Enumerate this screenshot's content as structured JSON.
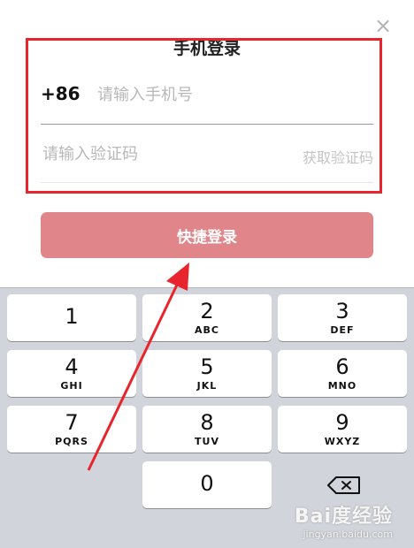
{
  "header": {
    "title": "手机登录"
  },
  "form": {
    "country_code": "+86",
    "phone_placeholder": "请输入手机号",
    "code_placeholder": "请输入验证码",
    "get_code_label": "获取验证码"
  },
  "login_button": {
    "label": "快捷登录"
  },
  "keyboard": {
    "keys": [
      {
        "num": "1",
        "letters": ""
      },
      {
        "num": "2",
        "letters": "ABC"
      },
      {
        "num": "3",
        "letters": "DEF"
      },
      {
        "num": "4",
        "letters": "GHI"
      },
      {
        "num": "5",
        "letters": "JKL"
      },
      {
        "num": "6",
        "letters": "MNO"
      },
      {
        "num": "7",
        "letters": "PQRS"
      },
      {
        "num": "8",
        "letters": "TUV"
      },
      {
        "num": "9",
        "letters": "WXYZ"
      },
      {
        "num": "0",
        "letters": ""
      }
    ]
  },
  "watermark": {
    "logo": "Bai度经验",
    "url": "jingyan.baidu.com"
  },
  "colors": {
    "annotation_red": "#e8252c",
    "button_pink": "#e0868a"
  }
}
